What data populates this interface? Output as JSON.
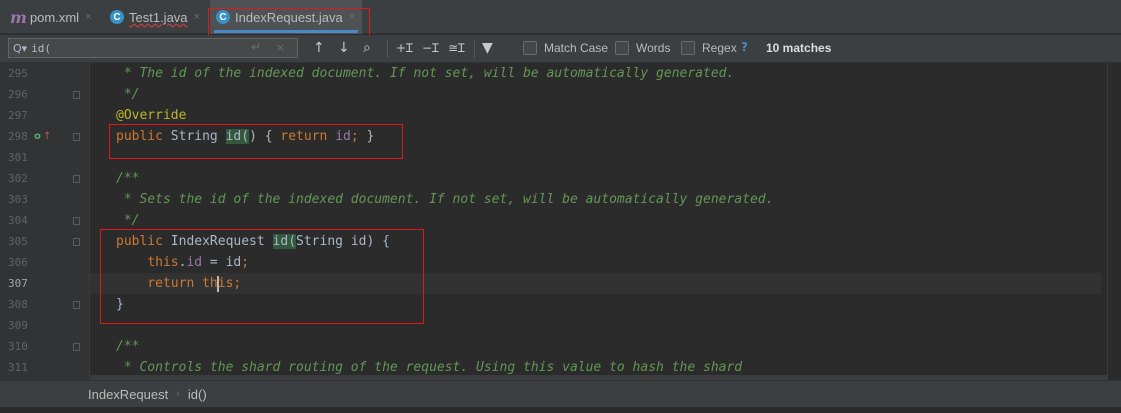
{
  "tabs": [
    {
      "label": "pom.xml",
      "icon": "maven-icon",
      "icon_glyph": "m"
    },
    {
      "label": "Test1.java",
      "icon": "java-class-icon",
      "icon_glyph": "C"
    },
    {
      "label": "IndexRequest.java",
      "icon": "java-class-icon",
      "icon_glyph": "C",
      "active": true
    }
  ],
  "tab_close_glyph": "×",
  "search": {
    "query": "id(",
    "options": {
      "match_case": "Match Case",
      "words": "Words",
      "regex": "Regex"
    },
    "help": "?",
    "matches": "10 matches"
  },
  "editor": {
    "current_line": 307,
    "lines": [
      {
        "num": "295",
        "text": " * The id of the indexed document. If not set, will be automatically generated."
      },
      {
        "num": "296",
        "text": " */"
      },
      {
        "num": "297",
        "text": "@Override"
      },
      {
        "num": "298",
        "text": "public String id() { return id; }"
      },
      {
        "num": "301",
        "text": ""
      },
      {
        "num": "302",
        "text": "/**"
      },
      {
        "num": "303",
        "text": " * Sets the id of the indexed document. If not set, will be automatically generated."
      },
      {
        "num": "304",
        "text": " */"
      },
      {
        "num": "305",
        "text": "public IndexRequest id(String id) {"
      },
      {
        "num": "306",
        "text": "    this.id = id;"
      },
      {
        "num": "307",
        "text": "    return this;"
      },
      {
        "num": "308",
        "text": "}"
      },
      {
        "num": "309",
        "text": ""
      },
      {
        "num": "310",
        "text": "/**"
      },
      {
        "num": "311",
        "text": " * Controls the shard routing of the request. Using this value to hash the shard"
      }
    ]
  },
  "breadcrumb": {
    "class_name": "IndexRequest",
    "method": "id()"
  },
  "colors": {
    "keyword": "#cc7832",
    "comment": "#629755",
    "annotation": "#bbb529",
    "field": "#9876aa",
    "match_highlight": "#32593d",
    "annotation_box": "#e0171b"
  }
}
